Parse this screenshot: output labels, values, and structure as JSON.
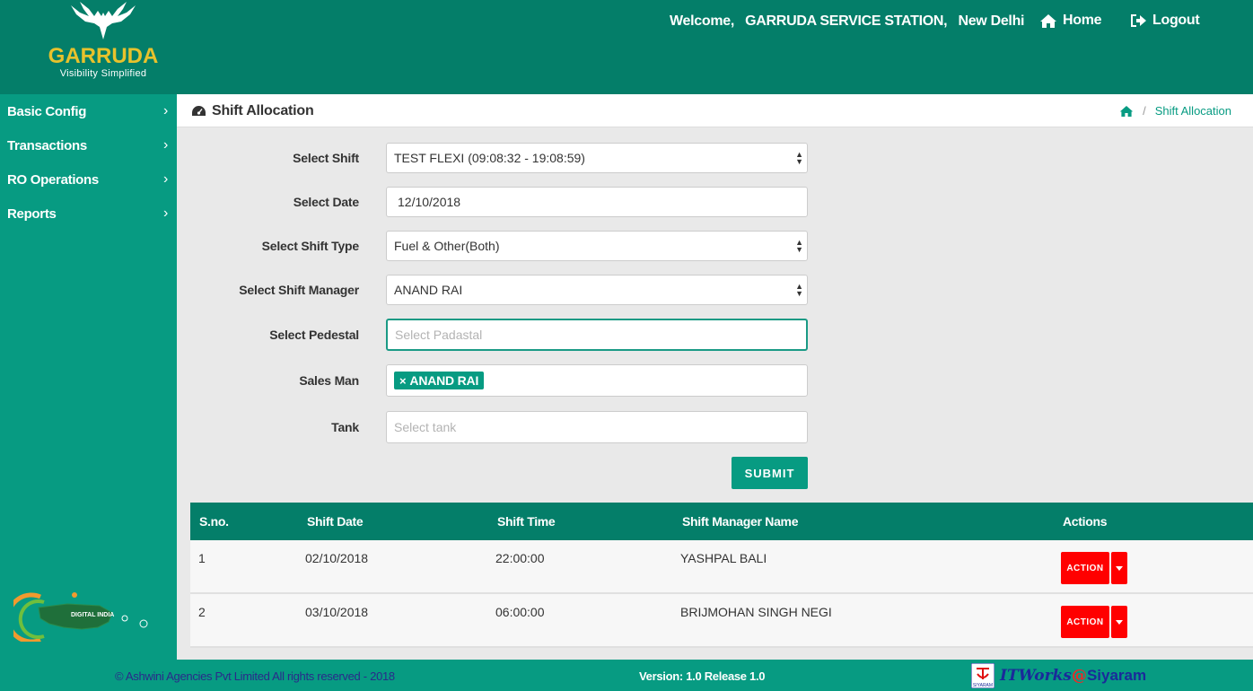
{
  "header": {
    "logo_name": "GARRUDA",
    "logo_tagline": "Visibility Simplified",
    "welcome_prefix": "Welcome,",
    "station_name": "GARRUDA SERVICE STATION,",
    "city": "New Delhi",
    "home_label": "Home",
    "logout_label": "Logout"
  },
  "sidebar": {
    "items": [
      {
        "label": "Basic Config"
      },
      {
        "label": "Transactions"
      },
      {
        "label": "RO Operations"
      },
      {
        "label": "Reports"
      }
    ],
    "emblem_text": "DIGITAL INDIA"
  },
  "page": {
    "title": "Shift Allocation",
    "breadcrumb_current": "Shift Allocation"
  },
  "form": {
    "shift_label": "Select Shift",
    "shift_value": "TEST FLEXI (09:08:32 - 19:08:59)",
    "date_label": "Select Date",
    "date_value": "12/10/2018",
    "shift_type_label": "Select Shift Type",
    "shift_type_value": "Fuel & Other(Both)",
    "manager_label": "Select Shift Manager",
    "manager_value": "ANAND RAI",
    "pedestal_label": "Select Pedestal",
    "pedestal_placeholder": "Select Padastal",
    "salesman_label": "Sales Man",
    "salesman_tag": "ANAND RAI",
    "tag_remove": "×",
    "tank_label": "Tank",
    "tank_placeholder": "Select tank",
    "submit_label": "SUBMIT"
  },
  "table": {
    "columns": [
      "S.no.",
      "Shift Date",
      "Shift Time",
      "Shift Manager Name",
      "Actions"
    ],
    "action_label": "ACTION",
    "rows": [
      {
        "sno": "1",
        "date": "02/10/2018",
        "time": "22:00:00",
        "manager": "YASHPAL BALI"
      },
      {
        "sno": "2",
        "date": "03/10/2018",
        "time": "06:00:00",
        "manager": "BRIJMOHAN SINGH NEGI"
      }
    ]
  },
  "footer": {
    "copyright": "© Ashwini Agencies Pvt Limited All rights reserved - 2018",
    "version": "Version: 1.0 Release 1.0",
    "brand_it": "ITWorks",
    "brand_at": "@",
    "brand_siyaram": "Siyaram",
    "brand_badge": "SIYARAM"
  },
  "colors": {
    "header_bg": "#047e69",
    "sidebar_bg": "#079b82",
    "accent": "#079b82",
    "logo_gold": "#e8c22c",
    "action_red": "#ff0000"
  }
}
